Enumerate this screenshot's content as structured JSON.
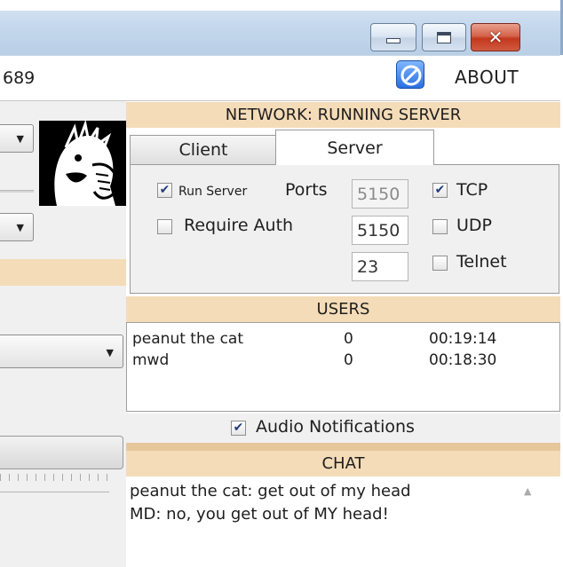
{
  "window": {
    "min_icon": "minimize-icon",
    "max_icon": "maximize-icon",
    "close_icon": "close-icon",
    "close_glyph": "✕"
  },
  "toolbar": {
    "counter_text": "689",
    "options_icon": "compass-icon",
    "about_label": "ABOUT"
  },
  "network": {
    "header": "NETWORK: RUNNING SERVER",
    "tabs": [
      {
        "label": "Client",
        "selected": false
      },
      {
        "label": "Server",
        "selected": true
      }
    ],
    "run_server": {
      "label": "Run Server",
      "checked": true
    },
    "require_auth": {
      "label": "Require Auth",
      "checked": false
    },
    "ports_label": "Ports",
    "ports": [
      "5150",
      "5150",
      "23"
    ],
    "protocols": [
      {
        "label": "TCP",
        "checked": true
      },
      {
        "label": "UDP",
        "checked": false
      },
      {
        "label": "Telnet",
        "checked": false
      }
    ]
  },
  "users": {
    "header": "USERS",
    "rows": [
      {
        "name": "peanut the cat",
        "count": "0",
        "time": "00:19:14"
      },
      {
        "name": "mwd",
        "count": "0",
        "time": "00:18:30"
      }
    ]
  },
  "audio": {
    "label": "Audio Notifications",
    "checked": true
  },
  "chat": {
    "header": "CHAT",
    "messages": [
      "peanut the cat: get out of my head",
      "MD: no, you get out of MY head!"
    ]
  },
  "check_glyph": "✔",
  "colors": {
    "section_header": "#f4dcb8",
    "titlebar": "#c4d7ec",
    "close_button": "#c2381f"
  }
}
